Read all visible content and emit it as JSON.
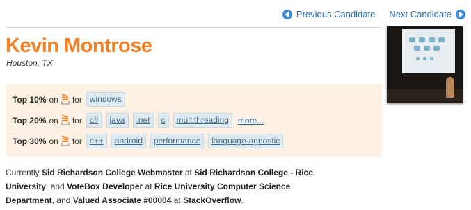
{
  "nav": {
    "prev_label": "Previous Candidate",
    "next_label": "Next Candidate"
  },
  "candidate": {
    "name": "Kevin Montrose",
    "location": "Houston, TX"
  },
  "ranks": [
    {
      "top": "Top 10%",
      "on": "on",
      "for": "for",
      "tags": [
        "windows"
      ]
    },
    {
      "top": "Top 20%",
      "on": "on",
      "for": "for",
      "tags": [
        "c#",
        "java",
        ".net",
        "c",
        "multithreading"
      ],
      "more": "more..."
    },
    {
      "top": "Top 30%",
      "on": "on",
      "for": "for",
      "tags": [
        "c++",
        "android",
        "performance",
        "language-agnostic"
      ]
    }
  ],
  "description": {
    "t1": "Currently ",
    "b1": "Sid Richardson College Webmaster",
    "t2": " at ",
    "b2": "Sid Richardson College - Rice University",
    "t3": ", and ",
    "b3": "VoteBox Developer",
    "t4": " at ",
    "b4": "Rice University Computer Science Department",
    "t5": ", and ",
    "b5": "Valued Associate #00004",
    "t6": " at ",
    "b6": "StackOverflow",
    "t7": "."
  },
  "colors": {
    "name": "#f48024",
    "link": "#2a6eb0",
    "tag_bg": "#e0eaf1",
    "tag_text": "#3e6d8e",
    "box_bg": "#fdf1e3"
  },
  "icons": {
    "prev": "circle-left-arrow-icon",
    "next": "circle-right-arrow-icon",
    "site": "stackoverflow-icon"
  }
}
